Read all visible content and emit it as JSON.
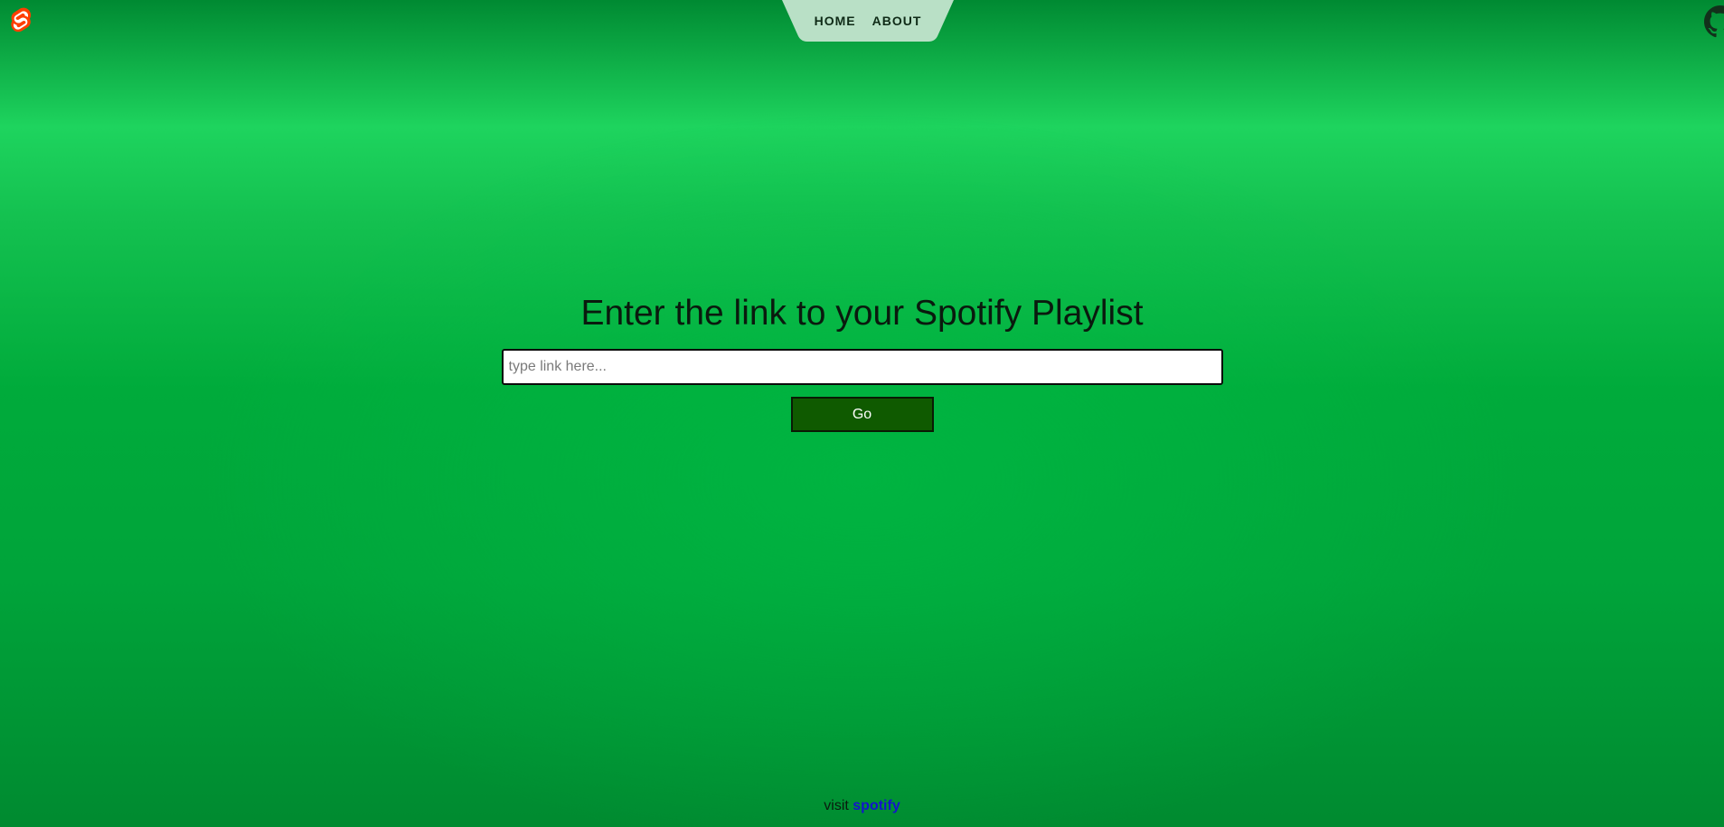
{
  "header": {
    "logo_icon": "svelte-logo-icon",
    "nav": [
      {
        "label": "HOME"
      },
      {
        "label": "ABOUT"
      }
    ],
    "github_icon": "github-icon"
  },
  "main": {
    "title": "Enter the link to your Spotify Playlist",
    "input": {
      "value": "",
      "placeholder": "type link here..."
    },
    "go_label": "Go"
  },
  "footer": {
    "prefix": "visit",
    "link_label": "spotify"
  },
  "colors": {
    "background_green": "#00a83a",
    "nav_tab": "#b9e0c6",
    "button_green": "#0f5a00",
    "link_blue": "#1414cc",
    "logo_orange": "#ff3e00"
  }
}
